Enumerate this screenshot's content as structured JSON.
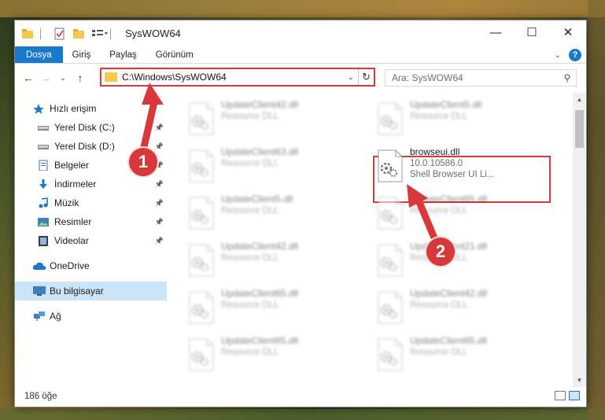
{
  "window": {
    "title": "SysWOW64",
    "controls": {
      "minimize": "—",
      "maximize": "☐",
      "close": "✕"
    }
  },
  "ribbon": {
    "tabs": [
      "Dosya",
      "Giriş",
      "Paylaş",
      "Görünüm"
    ]
  },
  "address": {
    "path": "C:\\Windows\\SysWOW64",
    "search_placeholder": "Ara: SysWOW64"
  },
  "sidebar": {
    "items": [
      {
        "label": "Hızlı erişim",
        "icon": "star-icon",
        "pinned": false
      },
      {
        "label": "Yerel Disk (C:)",
        "icon": "drive-icon",
        "pinned": true
      },
      {
        "label": "Yerel Disk (D:)",
        "icon": "drive-icon",
        "pinned": true
      },
      {
        "label": "Belgeler",
        "icon": "documents-icon",
        "pinned": true
      },
      {
        "label": "İndirmeler",
        "icon": "download-icon",
        "pinned": true
      },
      {
        "label": "Müzik",
        "icon": "music-icon",
        "pinned": true
      },
      {
        "label": "Resimler",
        "icon": "pictures-icon",
        "pinned": true
      },
      {
        "label": "Videolar",
        "icon": "videos-icon",
        "pinned": true
      },
      {
        "label": "OneDrive",
        "icon": "cloud-icon",
        "pinned": false
      },
      {
        "label": "Bu bilgisayar",
        "icon": "computer-icon",
        "pinned": false
      },
      {
        "label": "Ağ",
        "icon": "network-icon",
        "pinned": false
      }
    ]
  },
  "files": {
    "left_column": [
      {
        "name": "UpdateClient42.dll",
        "desc": "Resource DLL"
      },
      {
        "name": "UpdateClient63.dll",
        "desc": "Resource DLL"
      },
      {
        "name": "UpdateClient5.dll",
        "desc": "Resource DLL"
      },
      {
        "name": "UpdateClient42.dll",
        "desc": "Resource DLL"
      },
      {
        "name": "UpdateClient65.dll",
        "desc": "Resource DLL"
      },
      {
        "name": "UpdateClient65.dll",
        "desc": "Resource DLL"
      }
    ],
    "right_column": [
      {
        "name": "UpdateClient5.dll",
        "desc": "Resource DLL"
      },
      {
        "name": "browseui.dll",
        "desc": "10.0.10586.0",
        "desc2": "Shell Browser UI Li...",
        "highlight": true
      },
      {
        "name": "UpdateClient65.dll",
        "desc": "Resource DLL"
      },
      {
        "name": "UpdateClient21.dll",
        "desc": "Resource DLL"
      },
      {
        "name": "UpdateClient42.dll",
        "desc": "Resource DLL"
      },
      {
        "name": "UpdateClient65.dll",
        "desc": "Resource DLL"
      }
    ]
  },
  "status": {
    "count": "186 öğe"
  },
  "callouts": {
    "one": "1",
    "two": "2"
  },
  "colors": {
    "accent": "#1979ca",
    "highlight": "#d9383a"
  }
}
